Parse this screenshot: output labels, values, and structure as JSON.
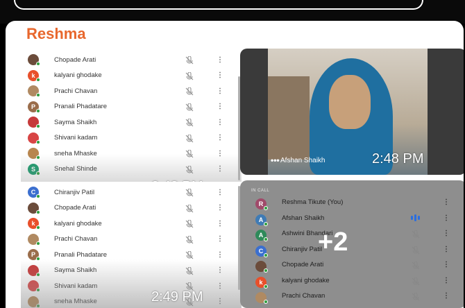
{
  "title": "Reshma",
  "panel_top": {
    "rows": [
      {
        "name": "Chopade Arati",
        "initial": "",
        "color": "#6b4c3b"
      },
      {
        "name": "kalyani ghodake",
        "initial": "k",
        "color": "#e8502b"
      },
      {
        "name": "Prachi Chavan",
        "initial": "",
        "color": "#b08a62"
      },
      {
        "name": "Pranali Phadatare",
        "initial": "P",
        "color": "#9a6d4b"
      },
      {
        "name": "Sayma Shaikh",
        "initial": "",
        "color": "#c63b3b"
      },
      {
        "name": "Shivani kadam",
        "initial": "",
        "color": "#d84545"
      },
      {
        "name": "sneha Mhaske",
        "initial": "",
        "color": "#b8864f"
      },
      {
        "name": "Snehal Shinde",
        "initial": "S",
        "color": "#1a9b6c"
      }
    ],
    "time": "2:48 PM"
  },
  "panel_bottom": {
    "rows": [
      {
        "name": "Chiranjiv Patil",
        "initial": "C",
        "color": "#3b6fcf"
      },
      {
        "name": "Chopade Arati",
        "initial": "",
        "color": "#6b4c3b"
      },
      {
        "name": "kalyani ghodake",
        "initial": "k",
        "color": "#e8502b"
      },
      {
        "name": "Prachi Chavan",
        "initial": "",
        "color": "#b08a62"
      },
      {
        "name": "Pranali Phadatare",
        "initial": "P",
        "color": "#9a6d4b"
      },
      {
        "name": "Sayma Shaikh",
        "initial": "",
        "color": "#c63b3b"
      },
      {
        "name": "Shivani kadam",
        "initial": "",
        "color": "#d84545"
      },
      {
        "name": "sneha Mhaske",
        "initial": "",
        "color": "#b8864f"
      }
    ],
    "time": "2:49 PM"
  },
  "video": {
    "name": "Afshan Shaikh",
    "time": "2:48 PM",
    "dots": "•••"
  },
  "in_call": {
    "header": "IN CALL",
    "overflow": "+2",
    "rows": [
      {
        "name": "Reshma Tikute (You)",
        "initial": "R",
        "color": "#a04a6a",
        "speaking": false,
        "mic_shown": false
      },
      {
        "name": "Afshan Shaikh",
        "initial": "A",
        "color": "#3f7bb5",
        "speaking": true,
        "mic_shown": false
      },
      {
        "name": "Ashwini Bhandari",
        "initial": "A",
        "color": "#2f8a5a",
        "speaking": false,
        "mic_shown": true
      },
      {
        "name": "Chiranjiv Patil",
        "initial": "C",
        "color": "#3b6fcf",
        "speaking": false,
        "mic_shown": true
      },
      {
        "name": "Chopade Arati",
        "initial": "",
        "color": "#6b4c3b",
        "speaking": false,
        "mic_shown": true
      },
      {
        "name": "kalyani ghodake",
        "initial": "k",
        "color": "#e8502b",
        "speaking": false,
        "mic_shown": true
      },
      {
        "name": "Prachi Chavan",
        "initial": "",
        "color": "#b08a62",
        "speaking": false,
        "mic_shown": true
      }
    ]
  }
}
